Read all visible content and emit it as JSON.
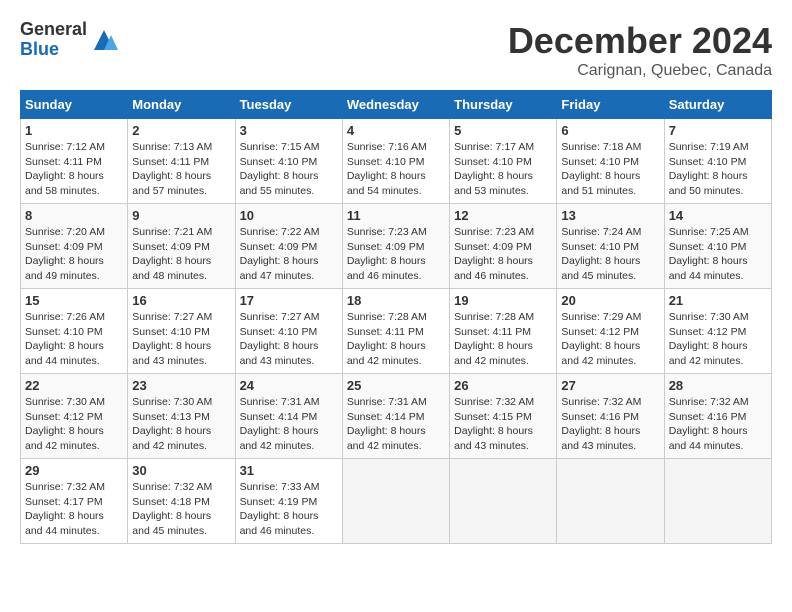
{
  "header": {
    "logo_line1": "General",
    "logo_line2": "Blue",
    "month_title": "December 2024",
    "location": "Carignan, Quebec, Canada"
  },
  "weekdays": [
    "Sunday",
    "Monday",
    "Tuesday",
    "Wednesday",
    "Thursday",
    "Friday",
    "Saturday"
  ],
  "weeks": [
    [
      {
        "day": "1",
        "sunrise": "7:12 AM",
        "sunset": "4:11 PM",
        "daylight": "8 hours and 58 minutes."
      },
      {
        "day": "2",
        "sunrise": "7:13 AM",
        "sunset": "4:11 PM",
        "daylight": "8 hours and 57 minutes."
      },
      {
        "day": "3",
        "sunrise": "7:15 AM",
        "sunset": "4:10 PM",
        "daylight": "8 hours and 55 minutes."
      },
      {
        "day": "4",
        "sunrise": "7:16 AM",
        "sunset": "4:10 PM",
        "daylight": "8 hours and 54 minutes."
      },
      {
        "day": "5",
        "sunrise": "7:17 AM",
        "sunset": "4:10 PM",
        "daylight": "8 hours and 53 minutes."
      },
      {
        "day": "6",
        "sunrise": "7:18 AM",
        "sunset": "4:10 PM",
        "daylight": "8 hours and 51 minutes."
      },
      {
        "day": "7",
        "sunrise": "7:19 AM",
        "sunset": "4:10 PM",
        "daylight": "8 hours and 50 minutes."
      }
    ],
    [
      {
        "day": "8",
        "sunrise": "7:20 AM",
        "sunset": "4:09 PM",
        "daylight": "8 hours and 49 minutes."
      },
      {
        "day": "9",
        "sunrise": "7:21 AM",
        "sunset": "4:09 PM",
        "daylight": "8 hours and 48 minutes."
      },
      {
        "day": "10",
        "sunrise": "7:22 AM",
        "sunset": "4:09 PM",
        "daylight": "8 hours and 47 minutes."
      },
      {
        "day": "11",
        "sunrise": "7:23 AM",
        "sunset": "4:09 PM",
        "daylight": "8 hours and 46 minutes."
      },
      {
        "day": "12",
        "sunrise": "7:23 AM",
        "sunset": "4:09 PM",
        "daylight": "8 hours and 46 minutes."
      },
      {
        "day": "13",
        "sunrise": "7:24 AM",
        "sunset": "4:10 PM",
        "daylight": "8 hours and 45 minutes."
      },
      {
        "day": "14",
        "sunrise": "7:25 AM",
        "sunset": "4:10 PM",
        "daylight": "8 hours and 44 minutes."
      }
    ],
    [
      {
        "day": "15",
        "sunrise": "7:26 AM",
        "sunset": "4:10 PM",
        "daylight": "8 hours and 44 minutes."
      },
      {
        "day": "16",
        "sunrise": "7:27 AM",
        "sunset": "4:10 PM",
        "daylight": "8 hours and 43 minutes."
      },
      {
        "day": "17",
        "sunrise": "7:27 AM",
        "sunset": "4:10 PM",
        "daylight": "8 hours and 43 minutes."
      },
      {
        "day": "18",
        "sunrise": "7:28 AM",
        "sunset": "4:11 PM",
        "daylight": "8 hours and 42 minutes."
      },
      {
        "day": "19",
        "sunrise": "7:28 AM",
        "sunset": "4:11 PM",
        "daylight": "8 hours and 42 minutes."
      },
      {
        "day": "20",
        "sunrise": "7:29 AM",
        "sunset": "4:12 PM",
        "daylight": "8 hours and 42 minutes."
      },
      {
        "day": "21",
        "sunrise": "7:30 AM",
        "sunset": "4:12 PM",
        "daylight": "8 hours and 42 minutes."
      }
    ],
    [
      {
        "day": "22",
        "sunrise": "7:30 AM",
        "sunset": "4:12 PM",
        "daylight": "8 hours and 42 minutes."
      },
      {
        "day": "23",
        "sunrise": "7:30 AM",
        "sunset": "4:13 PM",
        "daylight": "8 hours and 42 minutes."
      },
      {
        "day": "24",
        "sunrise": "7:31 AM",
        "sunset": "4:14 PM",
        "daylight": "8 hours and 42 minutes."
      },
      {
        "day": "25",
        "sunrise": "7:31 AM",
        "sunset": "4:14 PM",
        "daylight": "8 hours and 42 minutes."
      },
      {
        "day": "26",
        "sunrise": "7:32 AM",
        "sunset": "4:15 PM",
        "daylight": "8 hours and 43 minutes."
      },
      {
        "day": "27",
        "sunrise": "7:32 AM",
        "sunset": "4:16 PM",
        "daylight": "8 hours and 43 minutes."
      },
      {
        "day": "28",
        "sunrise": "7:32 AM",
        "sunset": "4:16 PM",
        "daylight": "8 hours and 44 minutes."
      }
    ],
    [
      {
        "day": "29",
        "sunrise": "7:32 AM",
        "sunset": "4:17 PM",
        "daylight": "8 hours and 44 minutes."
      },
      {
        "day": "30",
        "sunrise": "7:32 AM",
        "sunset": "4:18 PM",
        "daylight": "8 hours and 45 minutes."
      },
      {
        "day": "31",
        "sunrise": "7:33 AM",
        "sunset": "4:19 PM",
        "daylight": "8 hours and 46 minutes."
      },
      null,
      null,
      null,
      null
    ]
  ],
  "labels": {
    "sunrise": "Sunrise:",
    "sunset": "Sunset:",
    "daylight": "Daylight:"
  }
}
